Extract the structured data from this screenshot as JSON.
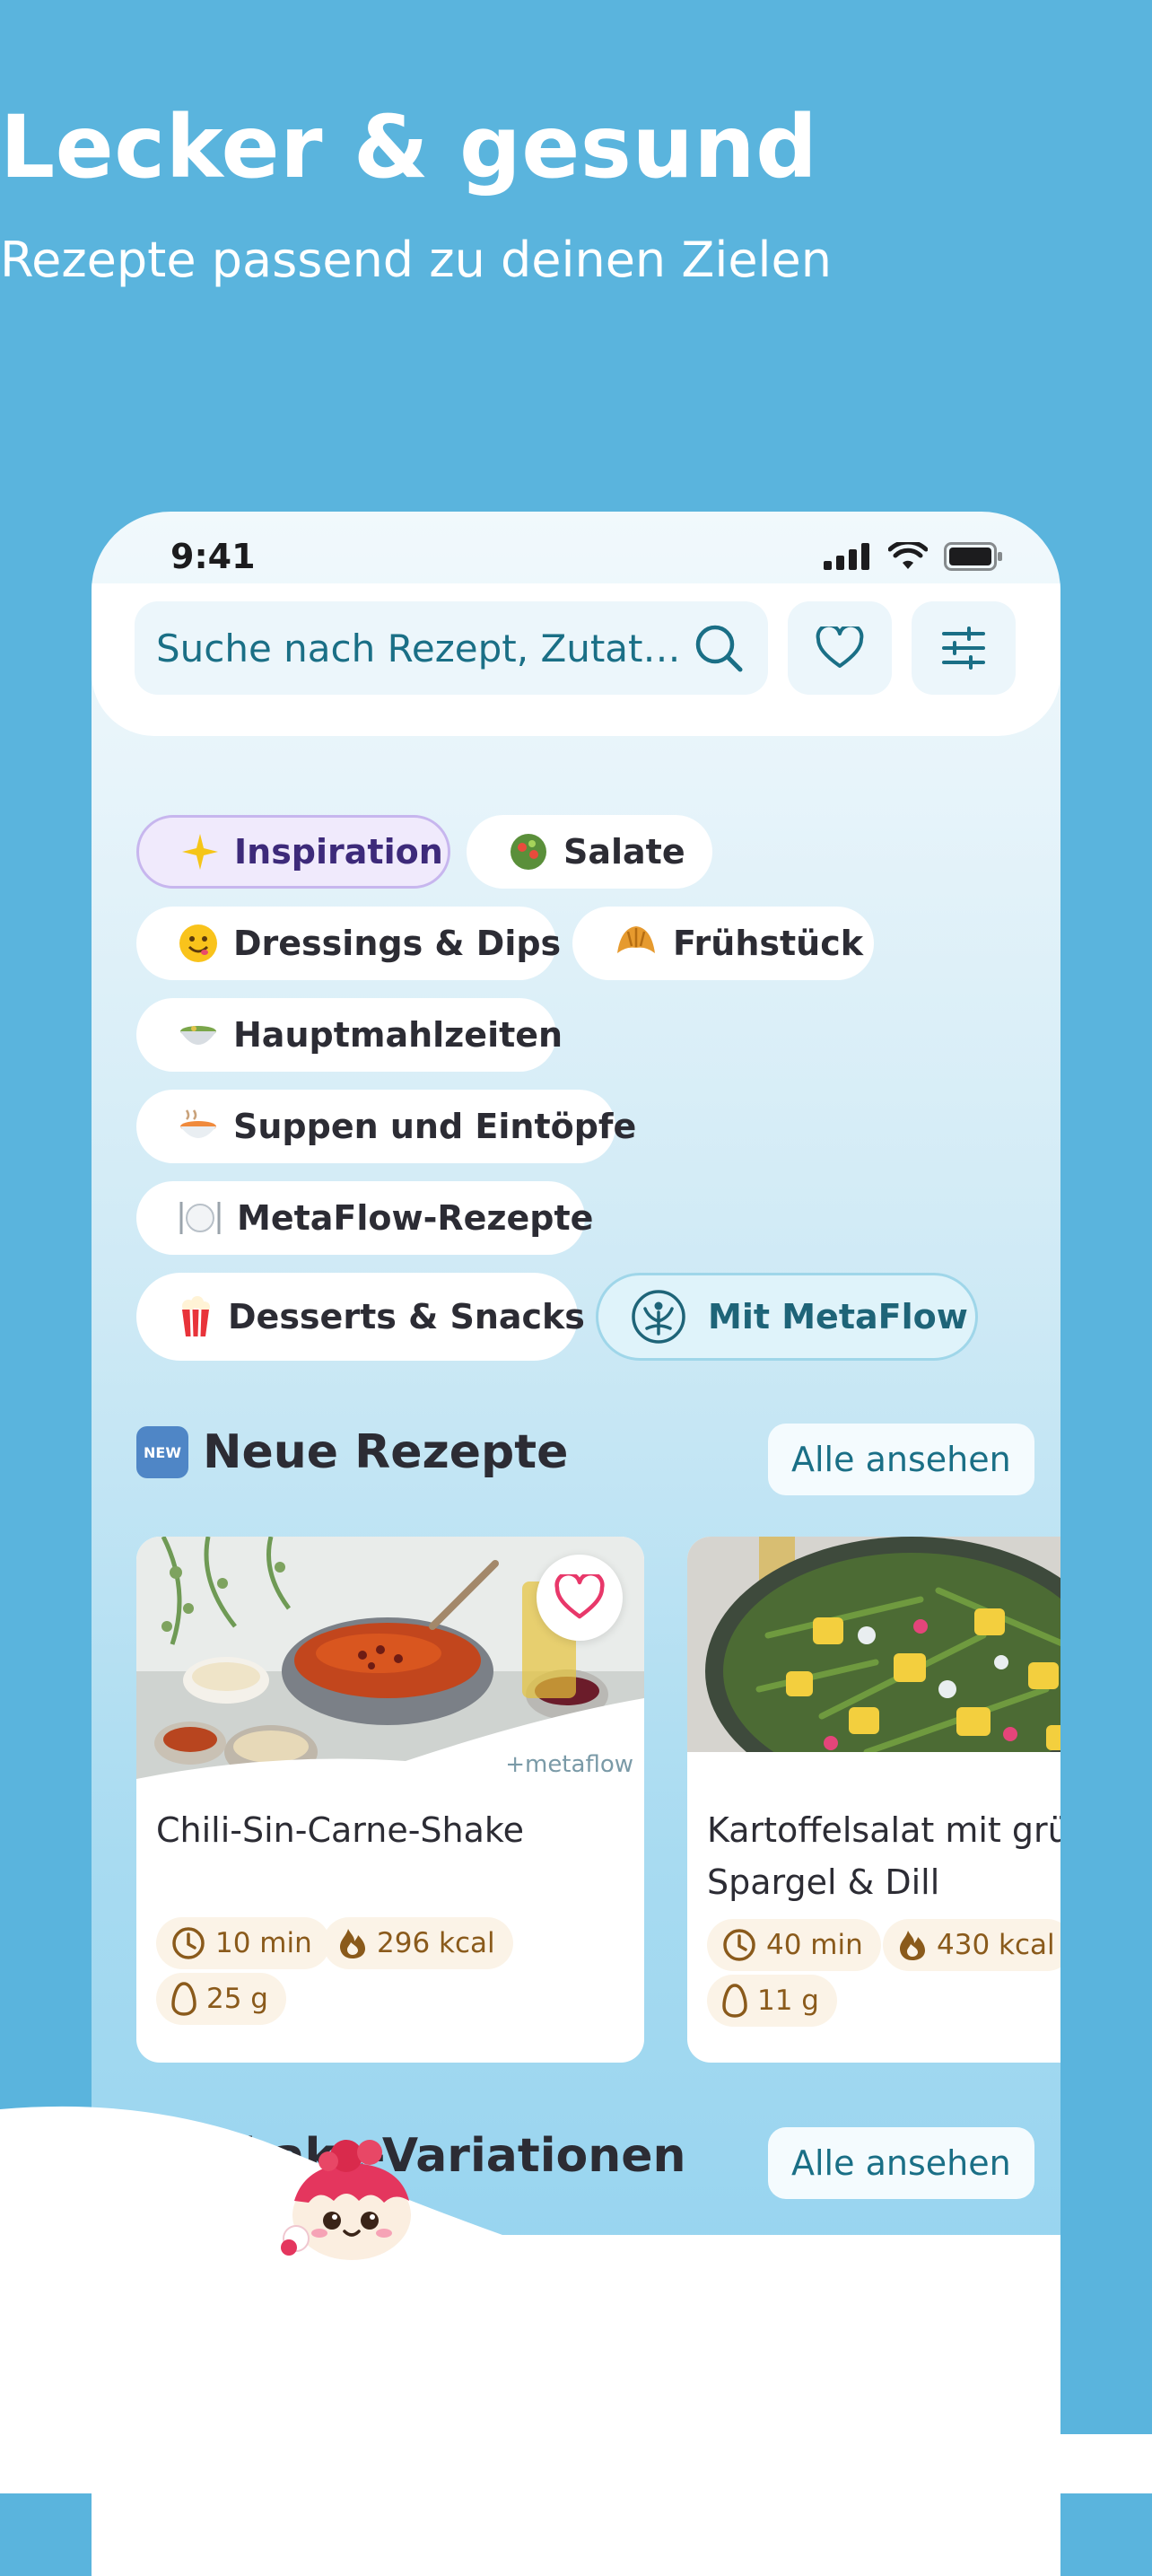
{
  "hero": {
    "title": "Lecker & gesund",
    "subtitle": "Rezepte passend zu deinen Zielen"
  },
  "status_bar": {
    "time": "9:41"
  },
  "search": {
    "placeholder": "Suche nach Rezept, Zutate..."
  },
  "categories": [
    {
      "label": "Inspiration",
      "icon": "sparkles-icon",
      "active": true
    },
    {
      "label": "Salate",
      "icon": "salad-icon"
    },
    {
      "label": "Dressings & Dips",
      "icon": "smiley-icon"
    },
    {
      "label": "Frühstück",
      "icon": "croissant-icon"
    },
    {
      "label": "Hauptmahlzeiten",
      "icon": "bowl-icon"
    },
    {
      "label": "Suppen und Eintöpfe",
      "icon": "soup-icon"
    },
    {
      "label": "MetaFlow-Rezepte",
      "icon": "plate-cutlery-icon"
    },
    {
      "label": "Desserts & Snacks",
      "icon": "popcorn-icon"
    },
    {
      "label": "Mit MetaFlow",
      "icon": "metaflow-logo-icon"
    }
  ],
  "new_recipes": {
    "title": "Neue Rezepte",
    "badge": "NEW",
    "see_all": "Alle ansehen",
    "cards": [
      {
        "title": "Chili-Sin-Carne-Shake",
        "watermark": "+metaflow",
        "time": "10 min",
        "kcal": "296 kcal",
        "protein": "25 g"
      },
      {
        "title_line1": "Kartoffelsalat mit grün",
        "title_line2": "Spargel & Dill",
        "time": "40 min",
        "kcal": "430 kcal",
        "protein": "11 g"
      }
    ]
  },
  "shake_section": {
    "title": "Shake-Variationen",
    "see_all": "Alle ansehen"
  },
  "colors": {
    "background": "#5ab4dd",
    "accent": "#1a6f86",
    "heart": "#e8386a",
    "pill_text": "#8a5a1b"
  }
}
